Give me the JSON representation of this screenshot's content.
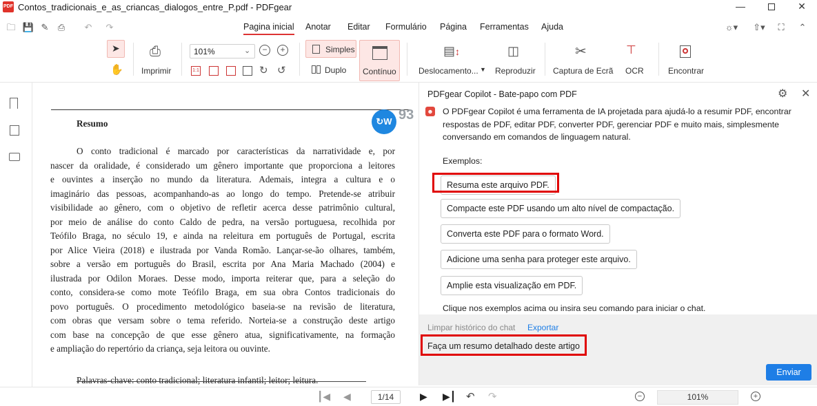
{
  "window": {
    "app_logo_text": "PDF",
    "title": "Contos_tradicionais_e_as_criancas_dialogos_entre_P.pdf - PDFgear",
    "minimize_icon": "minimize-icon",
    "maximize_icon": "maximize-icon",
    "close_icon": "close-icon"
  },
  "quick_access": [
    "open-icon",
    "save-icon",
    "save-as-icon",
    "print-icon",
    "undo-icon",
    "redo-icon"
  ],
  "menu": {
    "items": [
      "Pagina inicial",
      "Anotar",
      "Editar",
      "Formulário",
      "Página",
      "Ferramentas",
      "Ajuda"
    ],
    "active": "Pagina inicial"
  },
  "toolbar": {
    "print_label": "Imprimir",
    "zoom_value": "101%",
    "simple_label": "Simples",
    "double_label": "Duplo",
    "continuous_label": "Contínuo",
    "shift_label": "Deslocamento...",
    "play_label": "Reproduzir",
    "capture_label": "Captura de Ecrã",
    "ocr_label": "OCR",
    "find_label": "Encontrar",
    "accent_color": "#d33b2f"
  },
  "document": {
    "page_number_badge": "93",
    "heading": "Resumo",
    "paragraph_lines": [
      "O conto tradicional é marcado por características da narratividade e, por",
      "nascer da oralidade, é considerado um gênero importante que proporciona a leitores",
      "e ouvintes a inserção no mundo da literatura. Ademais, integra a cultura e o",
      "imaginário das pessoas, acompanhando-as ao longo do tempo. Pretende-se atribuir",
      "visibilidade ao gênero, com o objetivo de refletir acerca desse patrimônio cultural,",
      "por meio de análise do conto Caldo de pedra, na versão portuguesa, recolhida por",
      "Teófilo Braga, no século 19, e ainda na releitura em português de Portugal, escrita",
      "por Alice Vieira (2018) e ilustrada por Vanda Romão. Lançar-se-ão olhares, também,",
      "sobre a versão em português do Brasil, escrita por Ana Maria Machado (2004) e",
      "ilustrada por Odilon Moraes. Desse modo, importa reiterar que, para a seleção do",
      "conto, considera-se como mote Teófilo Braga, em sua obra Contos tradicionais do",
      "povo português. O procedimento metodológico baseia-se na revisão de literatura,",
      "com obras que versam sobre o tema referido. Norteia-se a construção deste artigo",
      "com base na concepção de que esse gênero atua, significativamente, na formação",
      "e ampliação do repertório da criança, seja leitora ou ouvinte."
    ],
    "keywords_line": "Palavras-chave: conto tradicional; literatura infantil; leitor; leitura."
  },
  "copilot": {
    "title": "PDFgear Copilot - Bate-papo com PDF",
    "intro": "O PDFgear Copilot é uma ferramenta de IA projetada para ajudá-lo a resumir PDF, encontrar respostas de PDF, editar PDF, converter PDF, gerenciar PDF e muito mais, simplesmente conversando em comandos de linguagem natural.",
    "examples_label": "Exemplos:",
    "examples": [
      "Resuma este arquivo PDF.",
      "Compacte este PDF usando um alto nível de compactação.",
      "Converta este PDF para o formato Word.",
      "Adicione uma senha para proteger este arquivo.",
      "Amplie esta visualização em PDF."
    ],
    "hint": "Clique nos exemplos acima ou insira seu comando para iniciar o chat.",
    "clear_history": "Limpar histórico do chat",
    "export": "Exportar",
    "input_value": "Faça um resumo detalhado deste artigo",
    "send_label": "Enviar",
    "send_color": "#1e7ee6",
    "highlight_color": "#e00000"
  },
  "statusbar": {
    "page_value": "1/14",
    "zoom_value": "101%"
  }
}
